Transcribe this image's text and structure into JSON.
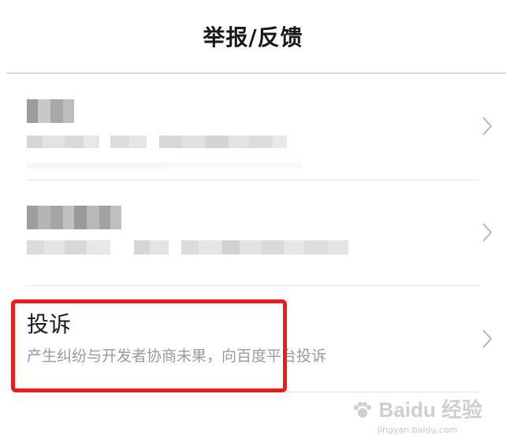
{
  "header": {
    "title": "举报/反馈"
  },
  "rows": [
    {
      "title_blurred": true,
      "desc_blurred": true
    },
    {
      "title_blurred": true,
      "desc_blurred": true
    },
    {
      "title": "投诉",
      "description": "产生纠纷与开发者协商未果，向百度平台投诉"
    }
  ],
  "annotation": {
    "highlight_color": "#ee1d1d"
  },
  "watermark": {
    "brand": "Baidu 经验",
    "url": "jingyan.baidu.com"
  },
  "icons": {
    "row_chevron": "chevron-right-icon",
    "watermark_logo": "baidu-paw-icon"
  }
}
